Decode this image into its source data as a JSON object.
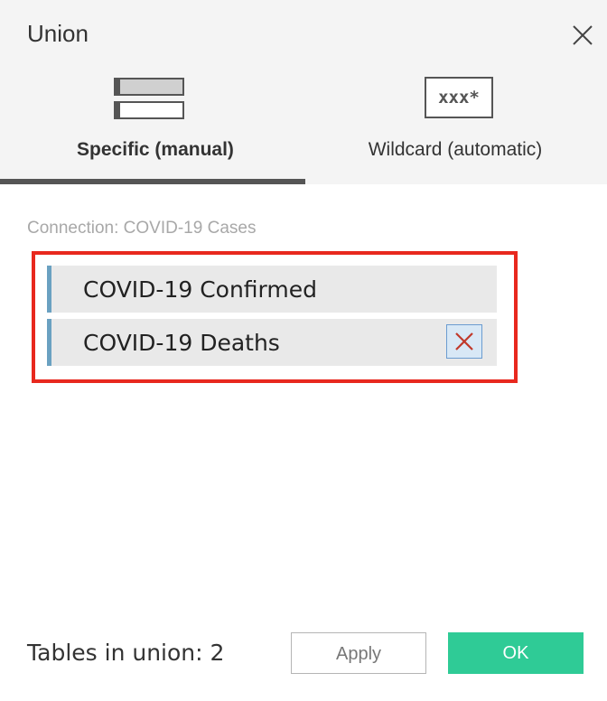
{
  "dialog": {
    "title": "Union",
    "close_icon": "close-icon"
  },
  "tabs": [
    {
      "label": "Specific (manual)",
      "icon": "table-list-icon",
      "selected": true
    },
    {
      "label": "Wildcard (automatic)",
      "icon": "wildcard-icon",
      "icon_text": "xxx*",
      "selected": false
    }
  ],
  "connection": {
    "label": "Connection: COVID-19 Cases"
  },
  "tables": [
    {
      "label": "COVID-19 Confirmed"
    },
    {
      "label": "COVID-19 Deaths",
      "remove_icon": "remove-x-icon"
    }
  ],
  "footer": {
    "count_label": "Tables in union: 2",
    "apply_label": "Apply",
    "ok_label": "OK"
  },
  "colors": {
    "highlight": "#e8281e",
    "row_accent": "#6aa1c1",
    "ok_button": "#2fcb96",
    "remove_x": "#c0392b"
  }
}
